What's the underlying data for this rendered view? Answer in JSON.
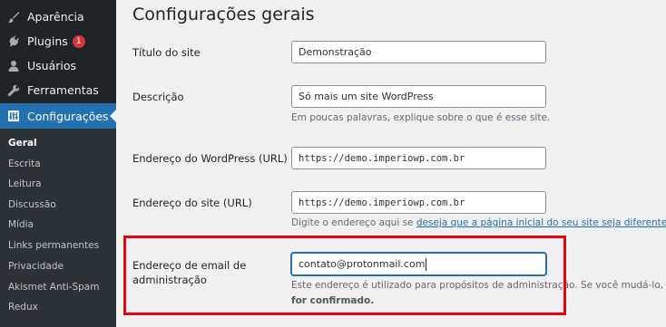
{
  "sidebar": {
    "items": [
      {
        "label": "Aparência",
        "icon": "paintbrush-icon"
      },
      {
        "label": "Plugins",
        "icon": "plugin-icon",
        "badge": "1"
      },
      {
        "label": "Usuários",
        "icon": "users-icon"
      },
      {
        "label": "Ferramentas",
        "icon": "wrench-icon"
      },
      {
        "label": "Configurações",
        "icon": "settings-icon",
        "active": true
      }
    ],
    "submenu": [
      "Geral",
      "Escrita",
      "Leitura",
      "Discussão",
      "Mídia",
      "Links permanentes",
      "Privacidade",
      "Akismet Anti-Spam",
      "Redux"
    ],
    "current_submenu": "Geral"
  },
  "main": {
    "title": "Configurações gerais",
    "fields": {
      "site_title": {
        "label": "Título do site",
        "value": "Demonstração"
      },
      "tagline": {
        "label": "Descrição",
        "value": "Só mais um site WordPress",
        "description": "Em poucas palavras, explique sobre o que é esse site."
      },
      "wp_url": {
        "label": "Endereço do WordPress (URL)",
        "value": "https://demo.imperiowp.com.br"
      },
      "site_url": {
        "label": "Endereço do site (URL)",
        "value": "https://demo.imperiowp.com.br",
        "description_prefix": "Digite o endereço aqui se ",
        "description_link": "deseja que a página inicial do seu site seja diferente do d"
      },
      "admin_email": {
        "label_line1": "Endereço de email de",
        "label_line2": "administração",
        "value": "contato@protonmail.com",
        "description_line1": "Este endereço é utilizado para propósitos de administração. Se você mudá-lo, nós lh",
        "description_line2": "for confirmado."
      }
    }
  },
  "colors": {
    "sidebar_bg": "#1d2327",
    "submenu_bg": "#2c3338",
    "accent": "#2271b1",
    "badge": "#d63638",
    "highlight": "#e3000f"
  }
}
